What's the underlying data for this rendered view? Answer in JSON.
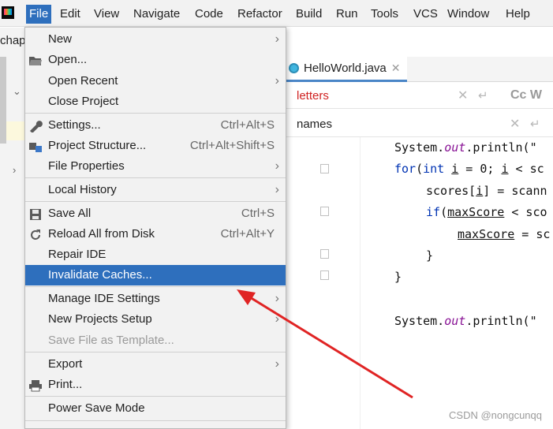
{
  "menubar": {
    "items": [
      "File",
      "Edit",
      "View",
      "Navigate",
      "Code",
      "Refactor",
      "Build",
      "Run",
      "Tools",
      "VCS",
      "Window",
      "Help"
    ]
  },
  "project_tab": "chap",
  "editor": {
    "tab": "HelloWorld.java",
    "find1": "letters",
    "find2": "names",
    "find_cc": "Cc W"
  },
  "file_menu": {
    "new": "New",
    "open": "Open...",
    "open_recent": "Open Recent",
    "close_project": "Close Project",
    "settings": "Settings...",
    "settings_shortcut": "Ctrl+Alt+S",
    "project_structure": "Project Structure...",
    "project_structure_shortcut": "Ctrl+Alt+Shift+S",
    "file_properties": "File Properties",
    "local_history": "Local History",
    "save_all": "Save All",
    "save_all_shortcut": "Ctrl+S",
    "reload": "Reload All from Disk",
    "reload_shortcut": "Ctrl+Alt+Y",
    "repair": "Repair IDE",
    "invalidate": "Invalidate Caches...",
    "manage_settings": "Manage IDE Settings",
    "new_projects_setup": "New Projects Setup",
    "save_template": "Save File as Template...",
    "export": "Export",
    "print": "Print...",
    "power_save": "Power Save Mode"
  },
  "watermark": "CSDN @nongcunqq",
  "colors": {
    "menu_highlight": "#2e6fbd",
    "arrow": "#e02424"
  }
}
